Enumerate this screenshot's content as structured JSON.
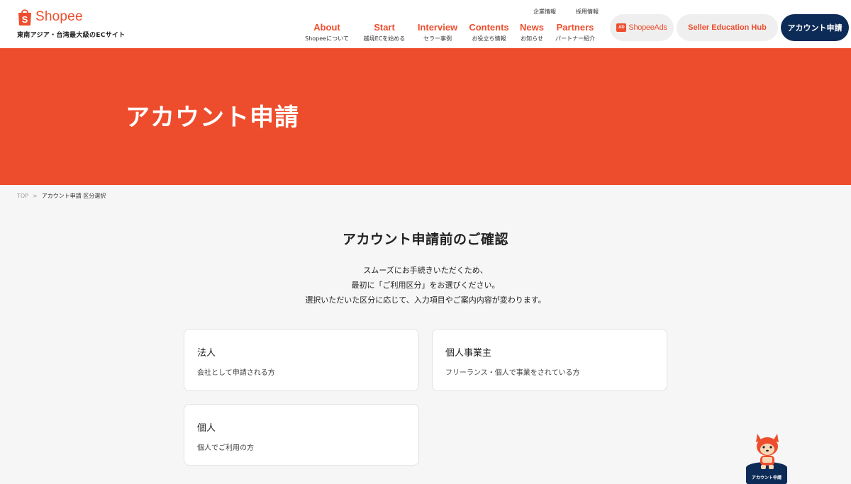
{
  "header": {
    "logo": {
      "wordmark": "Shopee",
      "tagline": "東南アジア・台湾最大級のECサイト"
    },
    "utility_links": [
      {
        "label": "企業情報"
      },
      {
        "label": "採用情報"
      }
    ],
    "nav": [
      {
        "en": "About",
        "jp": "Shopeeについて"
      },
      {
        "en": "Start",
        "jp": "越境ECを始める"
      },
      {
        "en": "Interview",
        "jp": "セラー事例"
      },
      {
        "en": "Contents",
        "jp": "お役立ち情報"
      },
      {
        "en": "News",
        "jp": "お知らせ"
      },
      {
        "en": "Partners",
        "jp": "パートナー紹介"
      }
    ],
    "ads_button": {
      "badge": "AD",
      "label": "ShopeeAds"
    },
    "seller_hub_button": "Seller Education Hub",
    "apply_button": "アカウント申請"
  },
  "hero": {
    "title": "アカウント申請"
  },
  "breadcrumb": {
    "top": "TOP",
    "separator": ">",
    "current": "アカウント申請 区分選択"
  },
  "main": {
    "title": "アカウント申請前のご確認",
    "intro": [
      "スムーズにお手続きいただくため、",
      "最初に「ご利用区分」をお選びください。",
      "選択いただいた区分に応じて、入力項目やご案内内容が変わります。"
    ],
    "options": [
      {
        "title": "法人",
        "desc": "会社として申請される方"
      },
      {
        "title": "個人事業主",
        "desc": "フリーランス・個人で事業をされている方"
      },
      {
        "title": "個人",
        "desc": "個人でご利用の方"
      }
    ]
  },
  "mascot_button": {
    "label": "アカウント申請"
  },
  "colors": {
    "brand": "#ee4d2d",
    "navy": "#0d2b57",
    "background": "#f6f6f6"
  }
}
